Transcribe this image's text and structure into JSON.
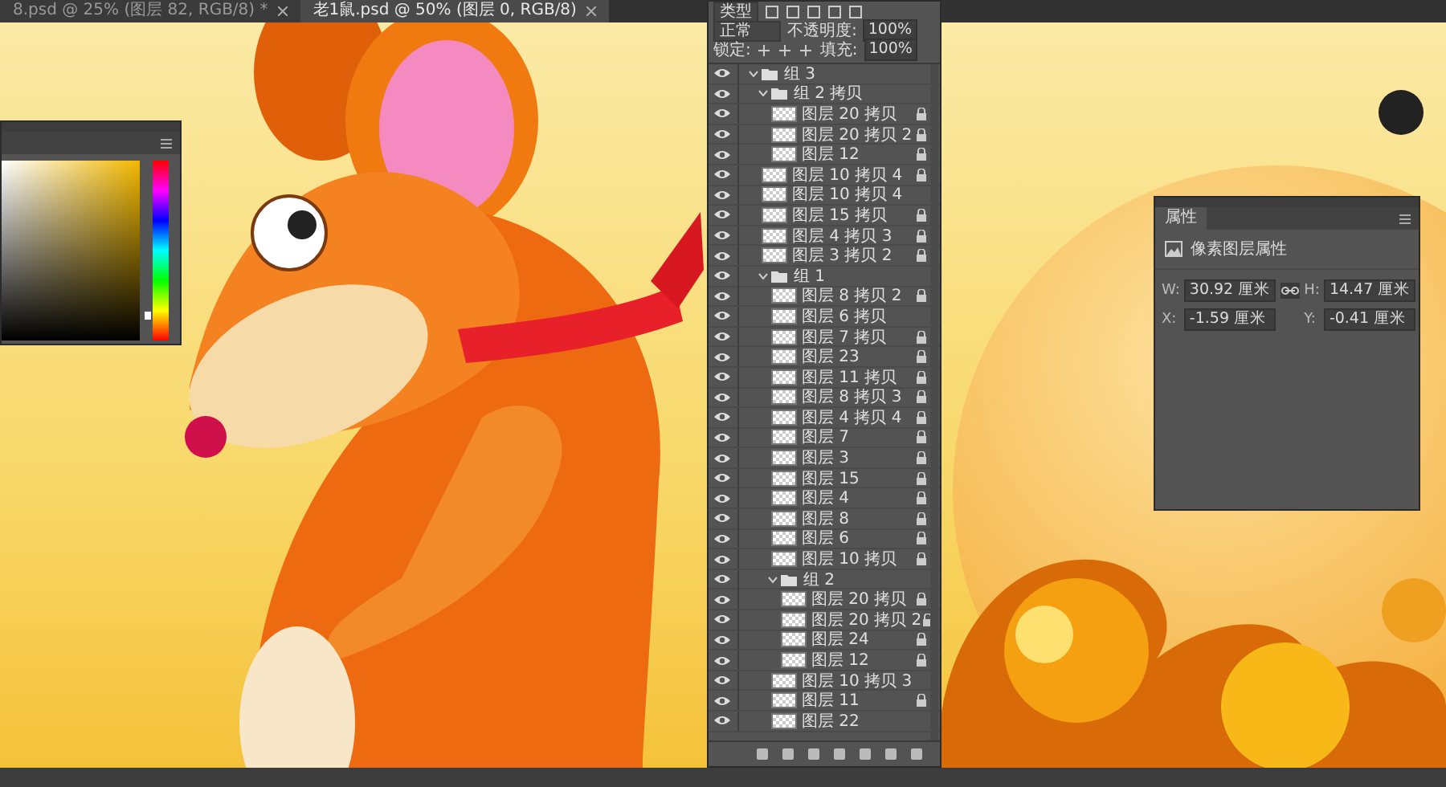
{
  "tabs": [
    {
      "title": "8.psd @ 25% (图层 82, RGB/8) *",
      "selected": false
    },
    {
      "title": "老1鼠.psd @ 50% (图层 0, RGB/8)",
      "selected": true
    }
  ],
  "color_panel": {
    "hue_slider": {
      "level": 0.12
    }
  },
  "layers_panel": {
    "filter": "类型",
    "blend_mode": "正常",
    "opacity_label": "不透明度:",
    "opacity": "100%",
    "lock_label": "锁定:",
    "fill_label": "填充:",
    "fill": "100%",
    "layers": [
      {
        "kind": "group",
        "name": "组 3",
        "expanded": true,
        "children": [
          {
            "kind": "group",
            "name": "组 2 拷贝",
            "expanded": true,
            "children": [
              {
                "kind": "layer",
                "name": "图层 20 拷贝",
                "locked": true
              },
              {
                "kind": "layer",
                "name": "图层 20 拷贝 2",
                "locked": true
              },
              {
                "kind": "layer",
                "name": "图层 12",
                "locked": true
              }
            ]
          },
          {
            "kind": "layer",
            "name": "图层 10 拷贝 4",
            "locked": true
          },
          {
            "kind": "layer",
            "name": "图层 10 拷贝 4",
            "locked": false
          },
          {
            "kind": "layer",
            "name": "图层 15 拷贝",
            "locked": true
          },
          {
            "kind": "layer",
            "name": "图层 4 拷贝 3",
            "locked": true
          },
          {
            "kind": "layer",
            "name": "图层 3 拷贝 2",
            "locked": true
          },
          {
            "kind": "group",
            "name": "组 1",
            "expanded": true,
            "children": [
              {
                "kind": "layer",
                "name": "图层 8 拷贝 2",
                "locked": true
              },
              {
                "kind": "layer",
                "name": "图层 6 拷贝",
                "locked": false
              },
              {
                "kind": "layer",
                "name": "图层 7 拷贝",
                "locked": true
              },
              {
                "kind": "layer",
                "name": "图层 23",
                "locked": true
              },
              {
                "kind": "layer",
                "name": "图层 11 拷贝",
                "locked": true
              },
              {
                "kind": "layer",
                "name": "图层 8 拷贝 3",
                "locked": true
              },
              {
                "kind": "layer",
                "name": "图层 4 拷贝 4",
                "locked": true
              },
              {
                "kind": "layer",
                "name": "图层 7",
                "locked": true
              },
              {
                "kind": "layer",
                "name": "图层 3",
                "locked": true
              },
              {
                "kind": "layer",
                "name": "图层 15",
                "locked": true
              },
              {
                "kind": "layer",
                "name": "图层 4",
                "locked": true
              },
              {
                "kind": "layer",
                "name": "图层 8",
                "locked": true
              },
              {
                "kind": "layer",
                "name": "图层 6",
                "locked": true
              },
              {
                "kind": "layer",
                "name": "图层 10 拷贝",
                "locked": true
              },
              {
                "kind": "group",
                "name": "组 2",
                "expanded": true,
                "children": [
                  {
                    "kind": "layer",
                    "name": "图层 20 拷贝",
                    "locked": true
                  },
                  {
                    "kind": "layer",
                    "name": "图层 20 拷贝 2",
                    "locked": true
                  },
                  {
                    "kind": "layer",
                    "name": "图层 24",
                    "locked": true
                  },
                  {
                    "kind": "layer",
                    "name": "图层 12",
                    "locked": true
                  }
                ]
              },
              {
                "kind": "layer",
                "name": "图层 10 拷贝 3",
                "locked": false
              },
              {
                "kind": "layer",
                "name": "图层 11",
                "locked": true
              },
              {
                "kind": "layer",
                "name": "图层 22",
                "locked": false
              }
            ]
          }
        ]
      }
    ]
  },
  "properties_panel": {
    "title": "属性",
    "section": "像素图层属性",
    "fields": [
      {
        "label": "W:",
        "value": "30.92 厘米"
      },
      {
        "label": "H:",
        "value": "14.47 厘米"
      },
      {
        "label": "X:",
        "value": "-1.59 厘米"
      },
      {
        "label": "Y:",
        "value": "-0.41 厘米"
      }
    ]
  }
}
